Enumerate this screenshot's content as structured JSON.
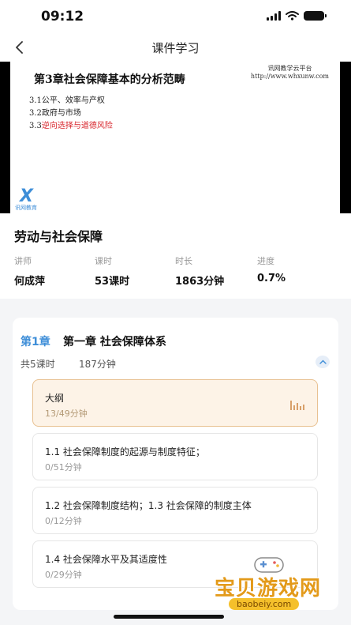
{
  "status_bar": {
    "time": "09:12"
  },
  "nav": {
    "title": "课件学习"
  },
  "slide": {
    "title": "第3章社会保障基本的分析范畴",
    "watermark_line1": "讯网教学云平台",
    "watermark_line2": "http://www.whxunw.com",
    "lines": [
      {
        "prefix": "3.1",
        "text": "公平、效率与产权"
      },
      {
        "prefix": "3.2",
        "text": "政府与市场"
      },
      {
        "prefix": "3.3",
        "text": "逆向选择与道德风险"
      }
    ],
    "logo_text": "讯网教育"
  },
  "course": {
    "title": "劳动与社会保障",
    "meta": [
      {
        "label": "讲师",
        "value": "何成萍"
      },
      {
        "label": "课时",
        "value": "53课时"
      },
      {
        "label": "时长",
        "value": "1863分钟"
      },
      {
        "label": "进度",
        "value": "0.7%"
      }
    ]
  },
  "chapter": {
    "number": "第1章",
    "name": "第一章 社会保障体系",
    "count": "共5课时",
    "minutes": "187分钟",
    "lessons": [
      {
        "title": "大纲",
        "progress": "13/49分钟",
        "active": true
      },
      {
        "title": "1.1 社会保障制度的起源与制度特征；",
        "progress": "0/51分钟"
      },
      {
        "title": "1.2 社会保障制度结构；1.3 社会保障的制度主体",
        "progress": "0/12分钟"
      },
      {
        "title": "1.4 社会保障水平及其适度性",
        "progress": "0/29分钟"
      }
    ]
  },
  "watermark": {
    "main": "宝贝游戏网",
    "url": "baobeiy.com"
  },
  "colors": {
    "accent": "#3e8ed8",
    "active_border": "#e8c191",
    "active_bg": "#fdf3e7",
    "slide_red": "#d8262d",
    "brand": "#e39a1a"
  },
  "icons": {
    "back": "chevron-left-icon",
    "collapse": "chevron-up-icon",
    "playing": "equalizer-icon"
  }
}
